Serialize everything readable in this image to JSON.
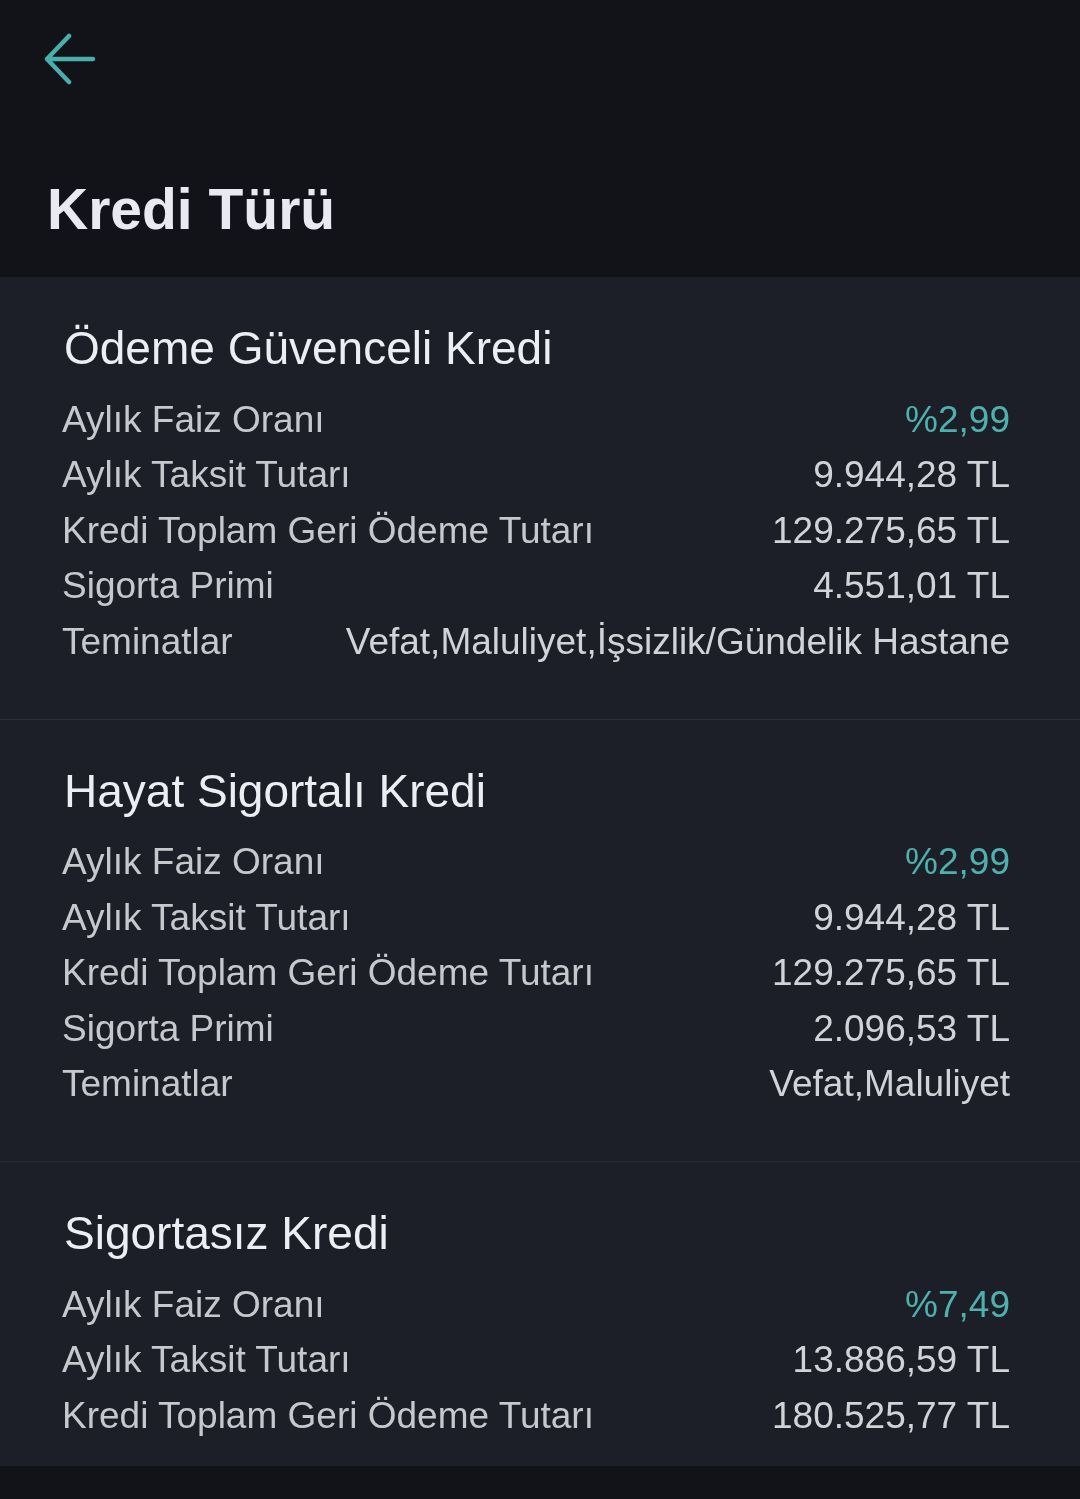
{
  "header": {
    "title": "Kredi Türü"
  },
  "loan_types": [
    {
      "title": "Ödeme Güvenceli Kredi",
      "rows": [
        {
          "label": "Aylık Faiz Oranı",
          "value": "%2,99",
          "kind": "rate"
        },
        {
          "label": "Aylık Taksit Tutarı",
          "value": "9.944,28 TL",
          "kind": "amount"
        },
        {
          "label": "Kredi Toplam Geri Ödeme Tutarı",
          "value": "129.275,65 TL",
          "kind": "amount"
        },
        {
          "label": "Sigorta Primi",
          "value": "4.551,01 TL",
          "kind": "amount"
        },
        {
          "label": "Teminatlar",
          "value": "Vefat,Maluliyet,İşsizlik/Gündelik Hastane",
          "kind": "text"
        }
      ]
    },
    {
      "title": "Hayat Sigortalı Kredi",
      "rows": [
        {
          "label": "Aylık Faiz Oranı",
          "value": "%2,99",
          "kind": "rate"
        },
        {
          "label": "Aylık Taksit Tutarı",
          "value": "9.944,28 TL",
          "kind": "amount"
        },
        {
          "label": "Kredi Toplam Geri Ödeme Tutarı",
          "value": "129.275,65 TL",
          "kind": "amount"
        },
        {
          "label": "Sigorta Primi",
          "value": "2.096,53 TL",
          "kind": "amount"
        },
        {
          "label": "Teminatlar",
          "value": "Vefat,Maluliyet",
          "kind": "text"
        }
      ]
    },
    {
      "title": "Sigortasız Kredi",
      "rows": [
        {
          "label": "Aylık Faiz Oranı",
          "value": "%7,49",
          "kind": "rate"
        },
        {
          "label": "Aylık Taksit Tutarı",
          "value": "13.886,59 TL",
          "kind": "amount"
        },
        {
          "label": "Kredi Toplam Geri Ödeme Tutarı",
          "value": "180.525,77 TL",
          "kind": "amount"
        }
      ]
    }
  ]
}
